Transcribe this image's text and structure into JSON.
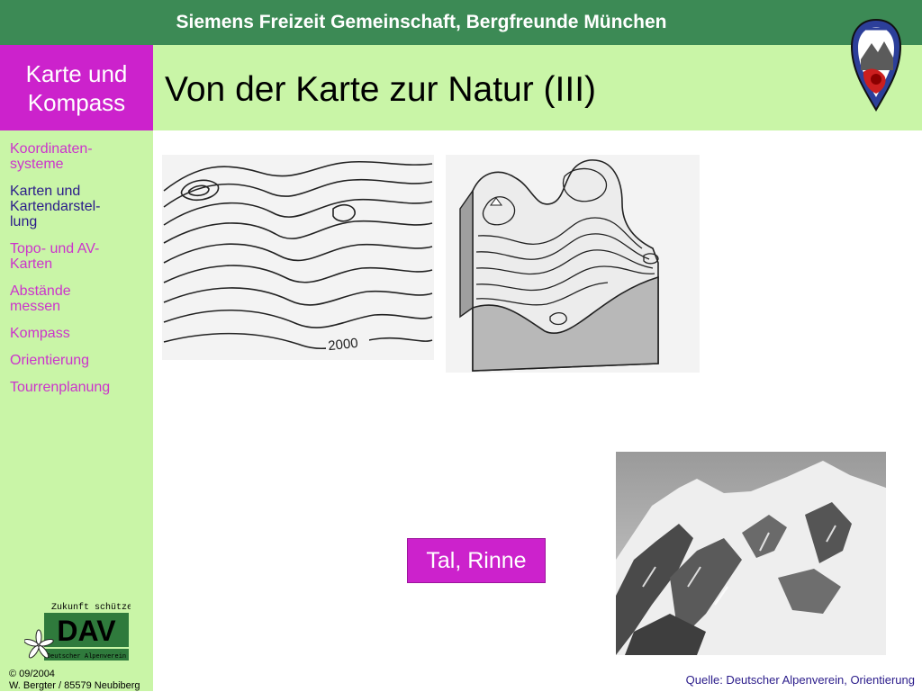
{
  "header": {
    "org_title": "Siemens Freizeit Gemeinschaft, Bergfreunde München",
    "section_label": "Karte und\nKompass",
    "slide_title": "Von der Karte zur Natur (III)"
  },
  "nav": {
    "items": [
      {
        "label": "Koordinaten-\nsysteme",
        "active": false
      },
      {
        "label": "Karten und\nKartendarstel-\nlung",
        "active": true
      },
      {
        "label": "Topo- und AV-\nKarten",
        "active": false
      },
      {
        "label": "Abstände\nmessen",
        "active": false
      },
      {
        "label": "Kompass",
        "active": false
      },
      {
        "label": "Orientierung",
        "active": false
      },
      {
        "label": "Tourrenplanung",
        "active": false
      }
    ]
  },
  "figures": {
    "contour_label": "2000",
    "callout_label": "Tal, Rinne"
  },
  "logos": {
    "dav_tagline": "Zukunft schützen",
    "dav_abbrev": "DAV",
    "dav_full": "Deutscher Alpenverein"
  },
  "footer": {
    "copyright": "© 09/2004\nW. Bergter / 85579 Neubiberg",
    "source": "Quelle: Deutscher Alpenverein, Orientierung"
  },
  "colors": {
    "topbar": "#3c8a55",
    "section_box": "#cc22cc",
    "band": "#c9f5a7",
    "nav_text": "#cc33cc",
    "nav_active": "#2a1b8a"
  }
}
